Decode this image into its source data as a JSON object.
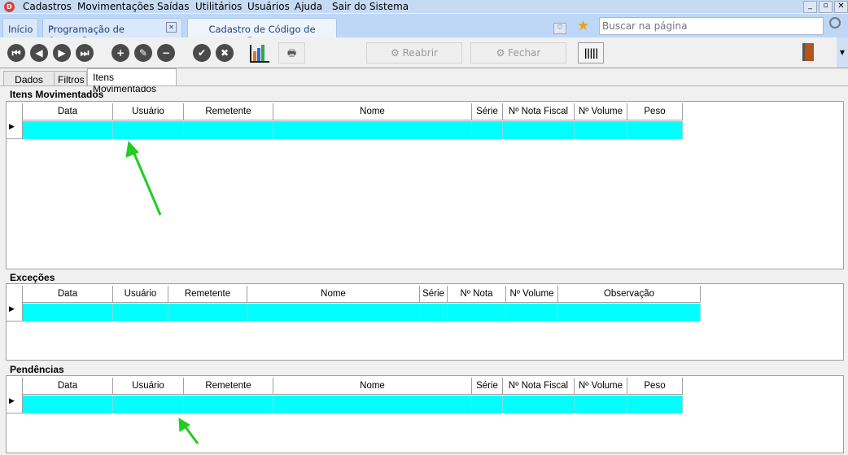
{
  "menu": {
    "items": [
      "Cadastros",
      "Movimentações",
      "Saídas",
      "Utilitários",
      "Usuários",
      "Ajuda",
      "Sair do Sistema"
    ]
  },
  "tabs": {
    "inicio": "Início",
    "programacao": "Programação de Operações",
    "cadastro": "Cadastro de Código de Barras"
  },
  "search": {
    "placeholder": "Buscar na página"
  },
  "toolbar": {
    "reabrir": "Reabrir",
    "fechar": "Fechar"
  },
  "subtabs": [
    "Dados",
    "Filtros",
    "Itens Movimentados"
  ],
  "sections": [
    {
      "title": "Itens Movimentados",
      "columns": [
        "Data",
        "Usuário",
        "Remetente",
        "Nome",
        "Série",
        "Nº Nota Fiscal",
        "Nº Volume",
        "Peso"
      ]
    },
    {
      "title": "Exceções",
      "columns": [
        "Data",
        "Usuário",
        "Remetente",
        "Nome",
        "Série",
        "Nº Nota",
        "Nº Volume",
        "Observação"
      ]
    },
    {
      "title": "Pendências",
      "columns": [
        "Data",
        "Usuário",
        "Remetente",
        "Nome",
        "Série",
        "Nº Nota Fiscal",
        "Nº Volume",
        "Peso"
      ]
    }
  ],
  "colors": {
    "selected_row": "#00ffff",
    "annotation_arrow": "#22cc22"
  }
}
